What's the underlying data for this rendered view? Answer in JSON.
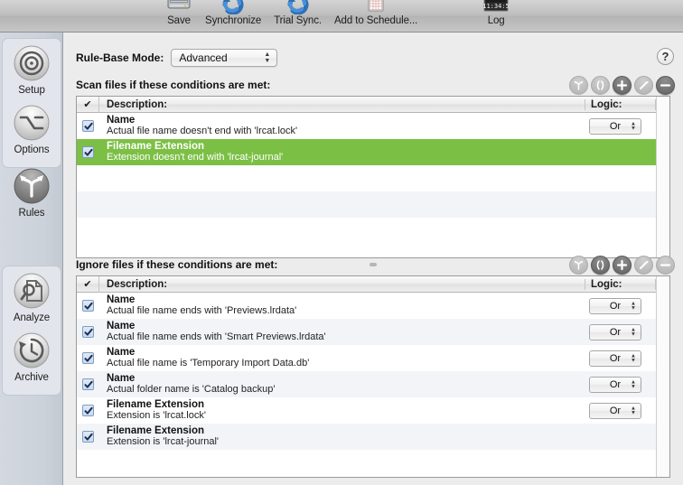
{
  "toolbar": {
    "items": [
      {
        "label": "Save",
        "icon": "disk-drive-icon"
      },
      {
        "label": "Synchronize",
        "icon": "sync-arrows-icon"
      },
      {
        "label": "Trial Sync.",
        "icon": "trial-sync-icon"
      },
      {
        "label": "Add to Schedule...",
        "icon": "calendar-icon"
      },
      {
        "label": "Log",
        "icon": "log-clock-icon"
      }
    ],
    "log_time": "11:34:5"
  },
  "sidebar": {
    "items": [
      {
        "label": "Setup",
        "icon": "target-icon",
        "selected": false
      },
      {
        "label": "Options",
        "icon": "option-key-icon",
        "selected": false
      },
      {
        "label": "Rules",
        "icon": "branch-icon",
        "selected": true
      },
      {
        "label": "Analyze",
        "icon": "magnifier-document-icon",
        "selected": false
      },
      {
        "label": "Archive",
        "icon": "clock-history-icon",
        "selected": false
      }
    ]
  },
  "mode": {
    "label": "Rule-Base Mode:",
    "value": "Advanced"
  },
  "help": {
    "glyph": "?"
  },
  "scan_section": {
    "title": "Scan files if these conditions are met:",
    "buttons": [
      {
        "name": "branch-icon",
        "enabled": false
      },
      {
        "name": "parentheses-icon",
        "enabled": false
      },
      {
        "name": "plus-icon",
        "enabled": true
      },
      {
        "name": "pencil-icon",
        "enabled": false
      },
      {
        "name": "minus-icon",
        "enabled": true
      }
    ],
    "columns": {
      "check": "✔",
      "description": "Description:",
      "logic": "Logic:"
    },
    "rows": [
      {
        "checked": true,
        "title": "Name",
        "detail": "Actual file name doesn't end with 'lrcat.lock'",
        "logic": "Or",
        "selected": false
      },
      {
        "checked": true,
        "title": "Filename Extension",
        "detail": "Extension doesn't end with 'lrcat-journal'",
        "logic": "",
        "selected": true
      }
    ],
    "empty_rows": 2
  },
  "ignore_section": {
    "title": "Ignore files if these conditions are met:",
    "buttons": [
      {
        "name": "branch-icon",
        "enabled": false
      },
      {
        "name": "parentheses-icon",
        "enabled": true
      },
      {
        "name": "plus-icon",
        "enabled": true
      },
      {
        "name": "pencil-icon",
        "enabled": false
      },
      {
        "name": "minus-icon",
        "enabled": false
      }
    ],
    "columns": {
      "check": "✔",
      "description": "Description:",
      "logic": "Logic:"
    },
    "rows": [
      {
        "checked": true,
        "title": "Name",
        "detail": "Actual file name ends with 'Previews.lrdata'",
        "logic": "Or",
        "selected": false
      },
      {
        "checked": true,
        "title": "Name",
        "detail": "Actual file name ends with 'Smart Previews.lrdata'",
        "logic": "Or",
        "selected": false
      },
      {
        "checked": true,
        "title": "Name",
        "detail": "Actual file name is 'Temporary Import Data.db'",
        "logic": "Or",
        "selected": false
      },
      {
        "checked": true,
        "title": "Name",
        "detail": "Actual folder name is 'Catalog backup'",
        "logic": "Or",
        "selected": false
      },
      {
        "checked": true,
        "title": "Filename Extension",
        "detail": "Extension is 'lrcat.lock'",
        "logic": "Or",
        "selected": false
      },
      {
        "checked": true,
        "title": "Filename Extension",
        "detail": "Extension is 'lrcat-journal'",
        "logic": "",
        "selected": false
      }
    ],
    "empty_rows": 1
  },
  "colors": {
    "selection_green": "#7cbf45",
    "row_alt": "#f2f4f8",
    "window_bg": "#ececec",
    "sidebar_bg": "#ccd2da"
  }
}
